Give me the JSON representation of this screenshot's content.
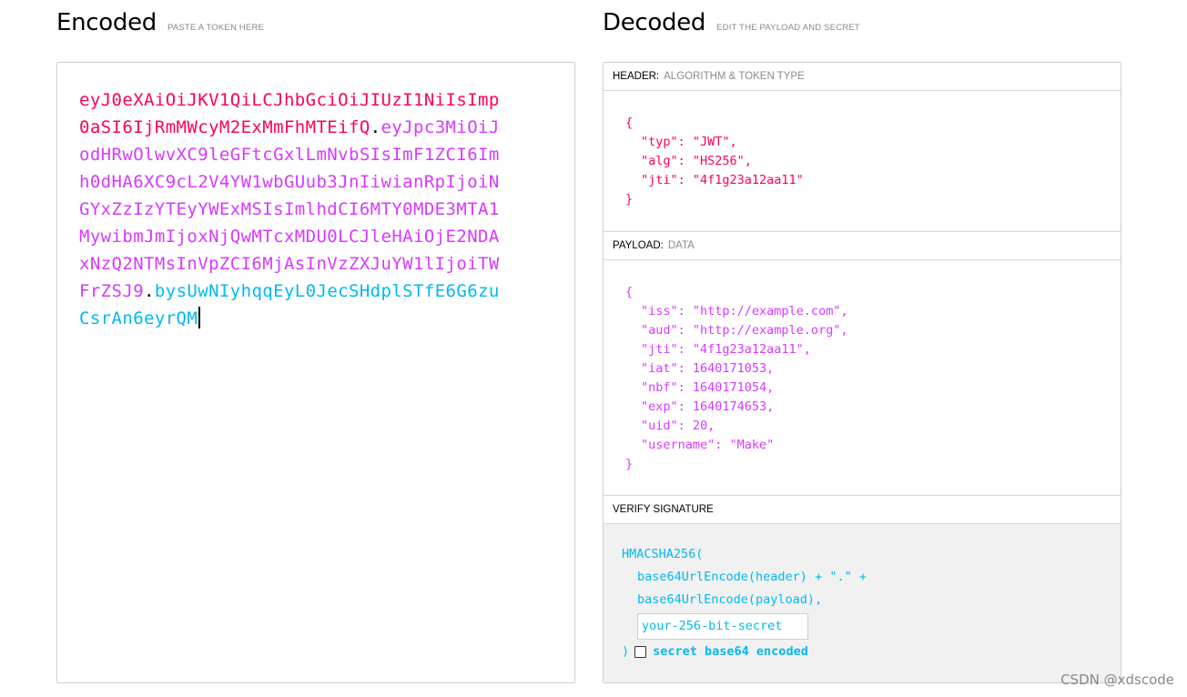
{
  "encoded": {
    "title": "Encoded",
    "subtitle": "PASTE A TOKEN HERE",
    "token_header": "eyJ0eXAiOiJKV1QiLCJhbGciOiJIUzI1NiIsImp0aSI6IjRmMWcyM2ExMmFhMTEifQ",
    "token_payload": "eyJpc3MiOiJodHRwOlwvXC9leGFtcGxlLmNvbSIsImF1ZCI6Imh0dHA6XC9cL2V4YW1wbGUub3JnIiwianRpIjoiNGYxZzIzYTEyYWExMSIsImlhdCI6MTY0MDE3MTA1MywibmJmIjoxNjQwMTcxMDU0LCJleHAiOjE2NDAxNzQ2NTMsInVpZCI6MjAsInVzZXJuYW1lIjoiTWFrZSJ9",
    "token_signature": "bysUwNIyhqqEyL0JecSHdplSTfE6G6zuCsrAn6eyrQM",
    "dot": "."
  },
  "decoded": {
    "title": "Decoded",
    "subtitle": "EDIT THE PAYLOAD AND SECRET",
    "header_section": {
      "label": "HEADER:",
      "desc": "ALGORITHM & TOKEN TYPE",
      "open": "{",
      "lines": [
        "\"typ\": \"JWT\",",
        "\"alg\": \"HS256\",",
        "\"jti\": \"4f1g23a12aa11\""
      ],
      "close": "}"
    },
    "payload_section": {
      "label": "PAYLOAD:",
      "desc": "DATA",
      "open": "{",
      "lines": [
        "\"iss\": \"http://example.com\",",
        "\"aud\": \"http://example.org\",",
        "\"jti\": \"4f1g23a12aa11\",",
        "\"iat\": 1640171053,",
        "\"nbf\": 1640171054,",
        "\"exp\": 1640174653,",
        "\"uid\": 20,",
        "\"username\": \"Make\""
      ],
      "close": "}"
    },
    "verify_section": {
      "label": "VERIFY SIGNATURE",
      "fn_open": "HMACSHA256(",
      "line1": "base64UrlEncode(header) + \".\" +",
      "line2": "base64UrlEncode(payload),",
      "secret_value": "your-256-bit-secret",
      "fn_close": ")",
      "checkbox_label": "secret base64 encoded",
      "checkbox_checked": false
    }
  },
  "watermark": "CSDN @xdscode",
  "colors": {
    "header": "#fb015b",
    "payload": "#d63aff",
    "signature": "#00b9f1"
  }
}
